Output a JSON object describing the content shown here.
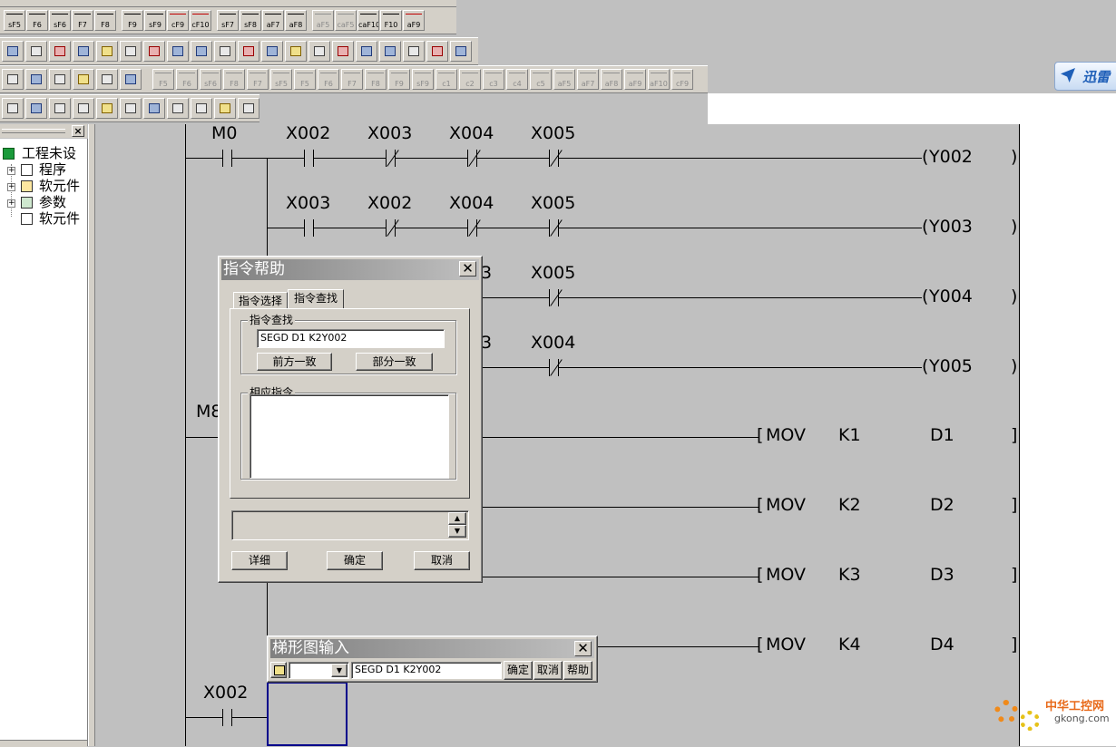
{
  "toolbar": {
    "ladder_keys": [
      {
        "label": "sF5",
        "kind": "no"
      },
      {
        "label": "F6",
        "kind": "nc"
      },
      {
        "label": "sF6",
        "kind": "no"
      },
      {
        "label": "F7",
        "kind": "coil"
      },
      {
        "label": "F8",
        "kind": "inst"
      },
      {
        "label": "F9",
        "kind": "hline"
      },
      {
        "label": "sF9",
        "kind": "vline"
      },
      {
        "label": "cF9",
        "kind": "del",
        "color": "#c00000"
      },
      {
        "label": "cF10",
        "kind": "del",
        "color": "#c00000"
      },
      {
        "label": "sF7",
        "kind": "no"
      },
      {
        "label": "sF8",
        "kind": "nc"
      },
      {
        "label": "aF7",
        "kind": "no"
      },
      {
        "label": "aF8",
        "kind": "nc"
      },
      {
        "label": "aF5",
        "kind": "dis"
      },
      {
        "label": "caF5",
        "kind": "dis"
      },
      {
        "label": "caF10",
        "kind": "no"
      },
      {
        "label": "F10",
        "kind": "hline"
      },
      {
        "label": "aF9",
        "kind": "del",
        "color": "#c00000"
      }
    ],
    "sfc_keys": [
      "F5",
      "F6",
      "sF6",
      "F8",
      "F7",
      "sF5",
      "F5",
      "F6",
      "F7",
      "F8",
      "F9",
      "sF9",
      "c1",
      "c2",
      "c3",
      "c4",
      "c5",
      "aF5",
      "aF7",
      "aF8",
      "aF9",
      "aF10",
      "cF9"
    ]
  },
  "project_tree": {
    "root": "工程未设",
    "items": [
      "程序",
      "软元件",
      "参数",
      "软元件"
    ]
  },
  "ladder": {
    "rung1": {
      "contacts": [
        "M0",
        "X002",
        "X003",
        "X004",
        "X005"
      ],
      "coil": "Y002"
    },
    "rung2": {
      "contacts": [
        "X003",
        "X002",
        "X004",
        "X005"
      ],
      "coil": "Y003"
    },
    "rung3": {
      "contacts": [
        "3",
        "X005"
      ],
      "coil": "Y004"
    },
    "rung4": {
      "contacts": [
        "3",
        "X004"
      ],
      "coil": "Y005"
    },
    "rung5_label": "M8",
    "movs": [
      {
        "op": "MOV",
        "src": "K1",
        "dst": "D1"
      },
      {
        "op": "MOV",
        "src": "K2",
        "dst": "D2"
      },
      {
        "op": "MOV",
        "src": "K3",
        "dst": "D3"
      },
      {
        "op": "MOV",
        "src": "K4",
        "dst": "D4"
      }
    ],
    "last_contact": "X002"
  },
  "help_dialog": {
    "title": "指令帮助",
    "tabs": [
      "指令选择",
      "指令查找"
    ],
    "group_find": "指令查找",
    "search_value": "SEGD D1 K2Y002",
    "btn_prefix": "前方一致",
    "btn_partial": "部分一致",
    "group_result": "相应指令",
    "btn_detail": "详细",
    "btn_ok": "确定",
    "btn_cancel": "取消"
  },
  "ladder_input": {
    "title": "梯形图输入",
    "value": "SEGD D1 K2Y002",
    "btn_ok": "确定",
    "btn_cancel": "取消",
    "btn_help": "帮助"
  },
  "xunlei_badge": "迅雷",
  "watermark": {
    "cn": "中华工控网",
    "url": "gkong.com"
  },
  "colors": {
    "titlebar_start": "#808080",
    "titlebar_end": "#c0c0c0",
    "cursor": "#00008b",
    "delete_red": "#c00000"
  }
}
